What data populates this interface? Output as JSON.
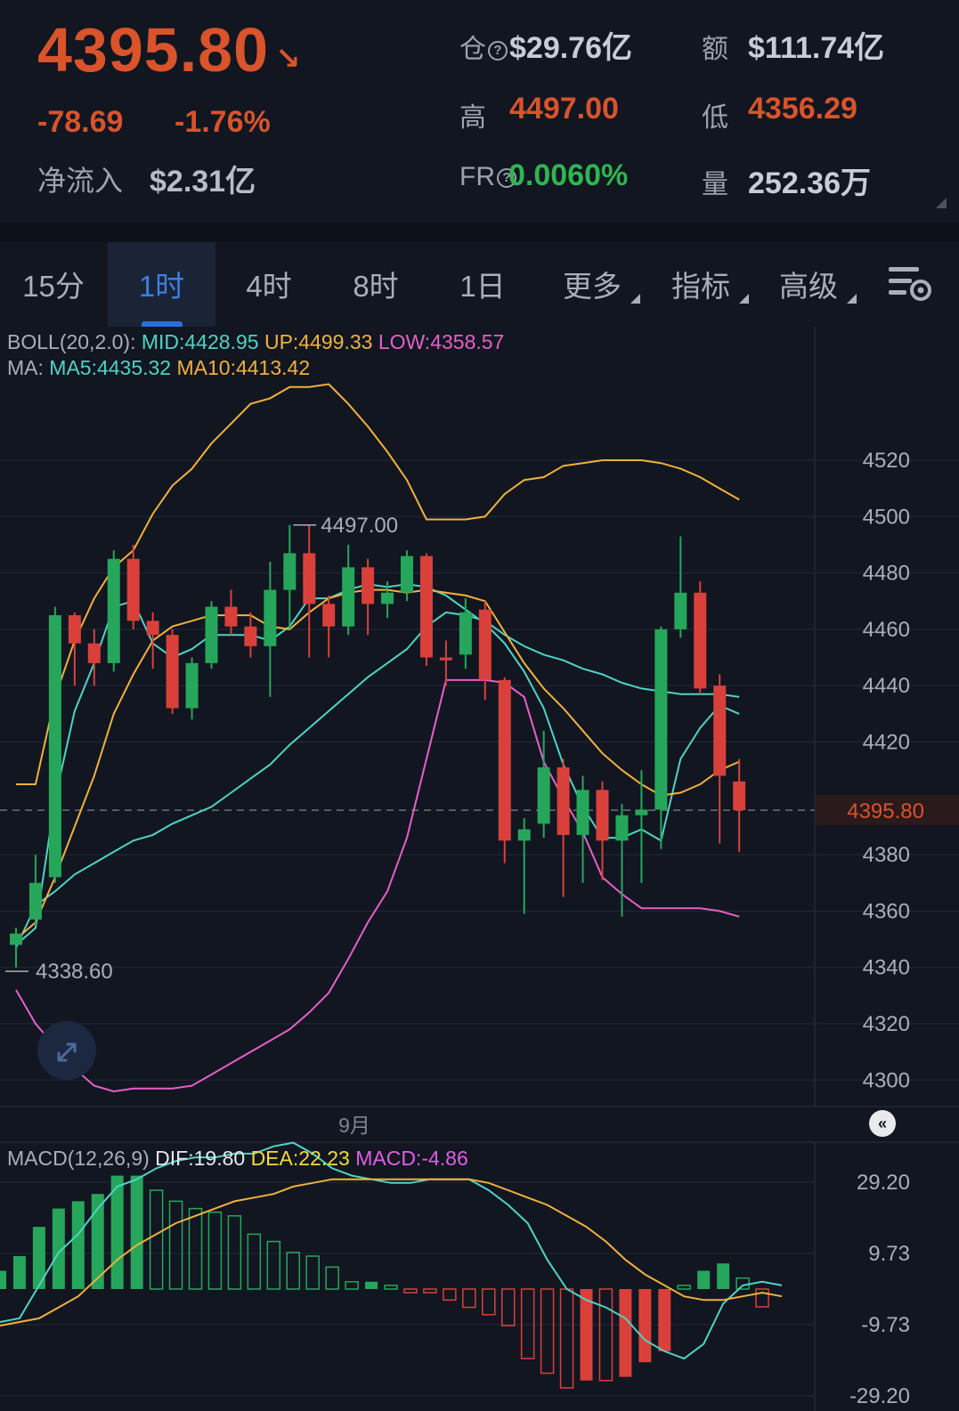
{
  "header": {
    "price": "4395.80",
    "price_arrow": "↘",
    "change": "-78.69",
    "change_pct": "-1.76%",
    "netflow_label": "净流入",
    "netflow_value": "$2.31亿",
    "oi_label": "仓",
    "oi_value": "$29.76亿",
    "turnover_label": "额",
    "turnover_value": "$111.74亿",
    "high_label": "高",
    "high_value": "4497.00",
    "low_label": "低",
    "low_value": "4356.29",
    "fr_label": "FR",
    "fr_value": "0.0060%",
    "volume_label": "量",
    "volume_value": "252.36万"
  },
  "tabs": [
    {
      "label": "15分",
      "active": false,
      "dropdown": false
    },
    {
      "label": "1时",
      "active": true,
      "dropdown": false
    },
    {
      "label": "4时",
      "active": false,
      "dropdown": false
    },
    {
      "label": "8时",
      "active": false,
      "dropdown": false
    },
    {
      "label": "1日",
      "active": false,
      "dropdown": false
    },
    {
      "label": "更多",
      "active": false,
      "dropdown": true
    },
    {
      "label": "指标",
      "active": false,
      "dropdown": true
    },
    {
      "label": "高级",
      "active": false,
      "dropdown": true
    }
  ],
  "colors": {
    "up": "#26a65b",
    "down": "#d9403a",
    "boll_mid": "#4fd3c4",
    "boll_up": "#f2b13a",
    "boll_low": "#e75fc8",
    "ma5": "#4fd3c4",
    "ma10": "#f2b13a",
    "dif": "#4fd3c4",
    "dea": "#f2b13a",
    "price_tag": "#d9532b",
    "background": "#111621"
  },
  "legend": {
    "boll_prefix": "BOLL(20,2.0):",
    "boll_mid": "MID:4428.95",
    "boll_up": "UP:4499.33",
    "boll_low": "LOW:4358.57",
    "ma_prefix": "MA:",
    "ma5": "MA5:4435.32",
    "ma10": "MA10:4413.42",
    "macd_prefix": "MACD(12,26,9)",
    "dif": "DIF:19.80",
    "dea": "DEA:22.23",
    "macd": "MACD:-4.86"
  },
  "annotations": {
    "high_mark": "4497.00",
    "low_mark": "4338.60",
    "current_price": "4395.80",
    "x_label": "9月",
    "back_icon": "«"
  },
  "chart_data": [
    {
      "type": "candlestick",
      "title": "",
      "x_label": "9月",
      "y_ticks": [
        "4520",
        "4500",
        "4480",
        "4460",
        "4440",
        "4420",
        "4380",
        "4360",
        "4340",
        "4320",
        "4300"
      ],
      "ylim": [
        4296,
        4540
      ],
      "current_price": 4395.8,
      "candles": [
        {
          "o": 4348,
          "c": 4352,
          "h": 4354,
          "l": 4340
        },
        {
          "o": 4357,
          "c": 4370,
          "h": 4380,
          "l": 4355
        },
        {
          "o": 4372,
          "c": 4465,
          "h": 4468,
          "l": 4370
        },
        {
          "o": 4465,
          "c": 4455,
          "h": 4466,
          "l": 4440
        },
        {
          "o": 4455,
          "c": 4448,
          "h": 4460,
          "l": 4440
        },
        {
          "o": 4448,
          "c": 4485,
          "h": 4488,
          "l": 4445
        },
        {
          "o": 4485,
          "c": 4463,
          "h": 4490,
          "l": 4460
        },
        {
          "o": 4463,
          "c": 4458,
          "h": 4466,
          "l": 4446
        },
        {
          "o": 4458,
          "c": 4432,
          "h": 4460,
          "l": 4430
        },
        {
          "o": 4432,
          "c": 4448,
          "h": 4450,
          "l": 4428
        },
        {
          "o": 4448,
          "c": 4468,
          "h": 4470,
          "l": 4446
        },
        {
          "o": 4468,
          "c": 4461,
          "h": 4474,
          "l": 4458
        },
        {
          "o": 4461,
          "c": 4454,
          "h": 4466,
          "l": 4450
        },
        {
          "o": 4454,
          "c": 4474,
          "h": 4484,
          "l": 4436
        },
        {
          "o": 4474,
          "c": 4487,
          "h": 4497,
          "l": 4460
        },
        {
          "o": 4487,
          "c": 4469,
          "h": 4497,
          "l": 4450
        },
        {
          "o": 4469,
          "c": 4461,
          "h": 4472,
          "l": 4450
        },
        {
          "o": 4461,
          "c": 4482,
          "h": 4490,
          "l": 4458
        },
        {
          "o": 4482,
          "c": 4469,
          "h": 4485,
          "l": 4458
        },
        {
          "o": 4469,
          "c": 4473,
          "h": 4477,
          "l": 4464
        },
        {
          "o": 4473,
          "c": 4486,
          "h": 4488,
          "l": 4470
        },
        {
          "o": 4486,
          "c": 4450,
          "h": 4487,
          "l": 4447
        },
        {
          "o": 4450,
          "c": 4449,
          "h": 4456,
          "l": 4440
        },
        {
          "o": 4451,
          "c": 4466,
          "h": 4471,
          "l": 4446
        },
        {
          "o": 4467,
          "c": 4442,
          "h": 4470,
          "l": 4435
        },
        {
          "o": 4442,
          "c": 4385,
          "h": 4443,
          "l": 4377
        },
        {
          "o": 4385,
          "c": 4389,
          "h": 4393,
          "l": 4359
        },
        {
          "o": 4391,
          "c": 4411,
          "h": 4424,
          "l": 4386
        },
        {
          "o": 4411,
          "c": 4387,
          "h": 4414,
          "l": 4365
        },
        {
          "o": 4387,
          "c": 4403,
          "h": 4408,
          "l": 4370
        },
        {
          "o": 4403,
          "c": 4385,
          "h": 4406,
          "l": 4371
        },
        {
          "o": 4385,
          "c": 4394,
          "h": 4398,
          "l": 4358
        },
        {
          "o": 4394,
          "c": 4396,
          "h": 4410,
          "l": 4370
        },
        {
          "o": 4396,
          "c": 4460,
          "h": 4461,
          "l": 4382
        },
        {
          "o": 4460,
          "c": 4473,
          "h": 4493,
          "l": 4457
        },
        {
          "o": 4473,
          "c": 4439,
          "h": 4477,
          "l": 4437
        },
        {
          "o": 4440,
          "c": 4408,
          "h": 4444,
          "l": 4384
        },
        {
          "o": 4406,
          "c": 4395.8,
          "h": 4414,
          "l": 4381
        }
      ],
      "series": [
        {
          "name": "UP",
          "values": [
            4405,
            4405,
            4436,
            4456,
            4471,
            4482,
            4488,
            4501,
            4511,
            4517,
            4526,
            4533,
            4540,
            4542,
            4546,
            4546,
            4547,
            4540,
            4532,
            4523,
            4513,
            4499,
            4499,
            4499,
            4500,
            4508,
            4513,
            4514,
            4518,
            4519,
            4520,
            4520,
            4520,
            4519,
            4517,
            4514,
            4510,
            4506
          ]
        },
        {
          "name": "MID",
          "values": [
            4347,
            4362,
            4367,
            4373,
            4377,
            4381,
            4385,
            4387,
            4391,
            4394,
            4397,
            4402,
            4407,
            4412,
            4419,
            4425,
            4431,
            4437,
            4443,
            4448,
            4453,
            4461,
            4466,
            4465,
            4463,
            4458,
            4454,
            4451,
            4449,
            4446,
            4444,
            4441,
            4439,
            4438,
            4437,
            4437,
            4437,
            4436
          ]
        },
        {
          "name": "LOW",
          "values": [
            4332,
            4320,
            4312,
            4304,
            4298,
            4296,
            4297,
            4297,
            4297,
            4298,
            4302,
            4306,
            4310,
            4314,
            4318,
            4324,
            4331,
            4343,
            4356,
            4367,
            4386,
            4414,
            4442,
            4442,
            4442,
            4441,
            4436,
            4413,
            4400,
            4388,
            4372,
            4366,
            4361,
            4361,
            4361,
            4361,
            4360,
            4358
          ]
        },
        {
          "name": "MA5",
          "values": [
            4348,
            4354,
            4400,
            4431,
            4448,
            4468,
            4470,
            4455,
            4450,
            4453,
            4458,
            4458,
            4458,
            4456,
            4461,
            4471,
            4471,
            4474,
            4476,
            4475,
            4476,
            4475,
            4472,
            4467,
            4462,
            4455,
            4445,
            4432,
            4412,
            4397,
            4386,
            4386,
            4389,
            4385,
            4414,
            4425,
            4433,
            4430
          ]
        },
        {
          "name": "MA10",
          "values": [
            4350,
            4356,
            4372,
            4390,
            4408,
            4430,
            4444,
            4456,
            4461,
            4463,
            4465,
            4465,
            4465,
            4461,
            4460,
            4466,
            4471,
            4473,
            4474,
            4474,
            4473,
            4474,
            4473,
            4472,
            4470,
            4459,
            4448,
            4439,
            4432,
            4424,
            4416,
            4410,
            4405,
            4401,
            4402,
            4405,
            4410,
            4413
          ]
        }
      ]
    },
    {
      "type": "bar",
      "title": "",
      "y_ticks": [
        "29.20",
        "9.73",
        "-9.73",
        "-29.20"
      ],
      "ylim": [
        -33,
        40
      ],
      "macd": [
        5,
        9,
        17,
        22,
        24,
        26,
        31,
        31,
        27,
        24,
        22,
        21,
        20,
        15,
        13,
        10,
        9,
        6,
        2,
        2,
        1,
        -1,
        -1,
        -3,
        -5,
        -7,
        -10,
        -19,
        -23,
        -27,
        -25,
        -25,
        -24,
        -20,
        -17,
        1,
        5,
        7,
        3,
        -4.86
      ],
      "series": [
        {
          "name": "DIF",
          "values": [
            -9,
            -8,
            1,
            10,
            15,
            22,
            28,
            30,
            33,
            35,
            36,
            36,
            37,
            37,
            39,
            40,
            37,
            33,
            31,
            30,
            29,
            29,
            30,
            30,
            30,
            27,
            23,
            18,
            8,
            0,
            -3,
            -5,
            -8,
            -14,
            -17,
            -19,
            -15,
            -4,
            1,
            2,
            1
          ]
        },
        {
          "name": "DEA",
          "values": [
            -10,
            -9,
            -8,
            -5,
            -2,
            3,
            8,
            12,
            15,
            18,
            20,
            22,
            24,
            25,
            26,
            28,
            29,
            30,
            30,
            30,
            30,
            30,
            30,
            30,
            30,
            29,
            27,
            25,
            23,
            20,
            17,
            13,
            8,
            4,
            1,
            -2,
            -3,
            -3,
            -2,
            -1,
            -2
          ]
        }
      ]
    }
  ]
}
